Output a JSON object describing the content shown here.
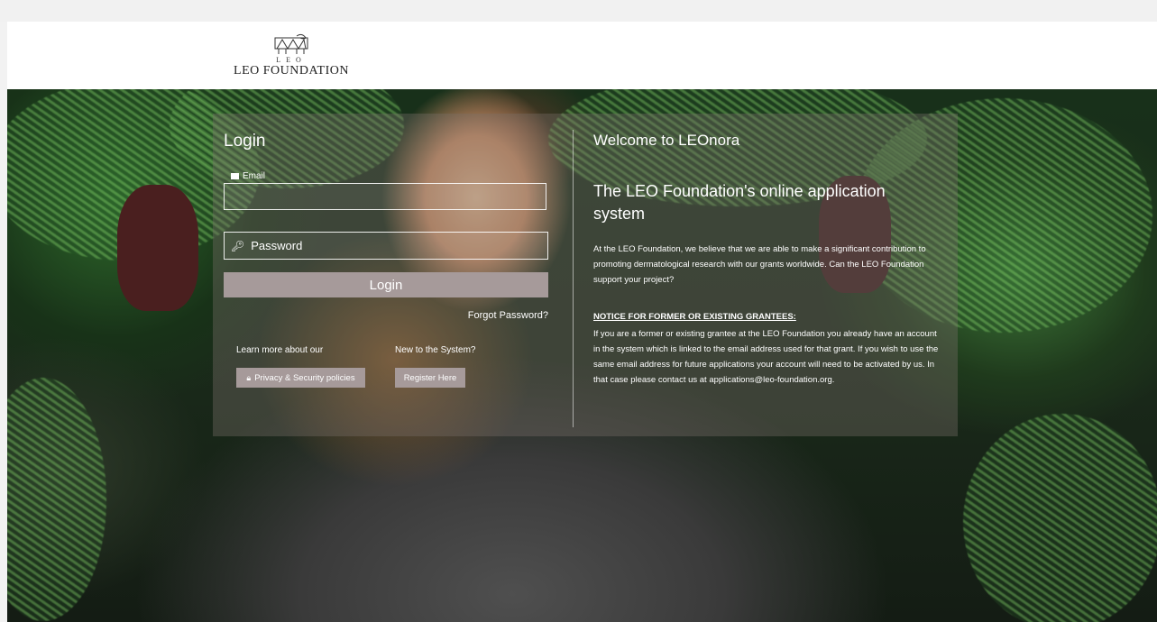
{
  "header": {
    "logo_sub": "LEO",
    "logo_name": "LEO FOUNDATION"
  },
  "login": {
    "title": "Login",
    "email_label": "Email",
    "email_value": "",
    "password_placeholder": "Password",
    "login_button": "Login",
    "forgot_password": "Forgot Password?",
    "learn_more_label": "Learn more about our",
    "privacy_button": "Privacy & Security policies",
    "new_system_label": "New to the System?",
    "register_button": "Register Here"
  },
  "welcome": {
    "title": "Welcome to LEOnora",
    "subtitle": "The LEO Foundation's online application system",
    "intro": "At the LEO Foundation, we believe that we are able to make a significant contribution to promoting dermatological research with our grants worldwide. Can the LEO Foundation support your project?",
    "notice_title": "NOTICE FOR FORMER OR EXISTING GRANTEES:",
    "notice_body": "If you are a former or existing grantee at the LEO Foundation you already have an account in the system which is linked to the email address used for that grant. If you wish to use the same email address for future applications your account will need to be activated by us. In that case please contact us at applications@leo-foundation.org."
  },
  "icons": {
    "email": "envelope-icon",
    "password": "key-icon",
    "privacy": "lock-icon",
    "logo": "lion-logo-icon"
  },
  "colors": {
    "button_bg": "#a69a9a",
    "text": "#ffffff",
    "header_bg": "#ffffff"
  }
}
